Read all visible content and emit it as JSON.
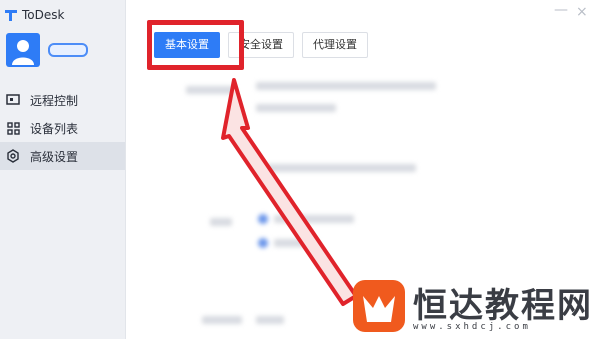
{
  "app": {
    "title": "ToDesk"
  },
  "window": {
    "minimize_icon": "minimize-icon",
    "close_label": "×"
  },
  "sidebar": {
    "items": [
      {
        "label": "远程控制",
        "icon": "remote-control-icon"
      },
      {
        "label": "设备列表",
        "icon": "device-grid-icon"
      },
      {
        "label": "高级设置",
        "icon": "gear-icon",
        "active": true
      }
    ]
  },
  "tabs": [
    {
      "label": "基本设置",
      "active": true
    },
    {
      "label": "安全设置"
    },
    {
      "label": "代理设置"
    }
  ],
  "watermark": {
    "text": "恒达教程网",
    "url": "www.sxhdcj.com"
  },
  "colors": {
    "accent": "#2e7cf6",
    "highlight": "#e0232b",
    "sidebar_bg": "#eef0f4"
  }
}
